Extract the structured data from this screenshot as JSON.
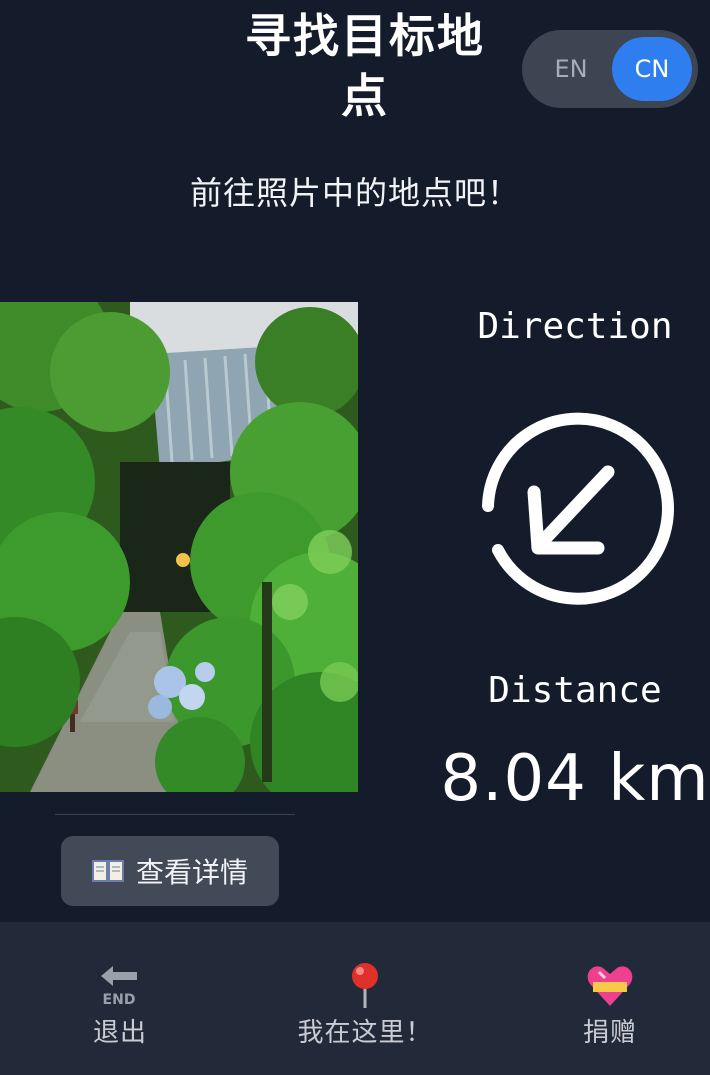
{
  "header": {
    "title": "寻找目标地点",
    "language": {
      "en": "EN",
      "cn": "CN",
      "active": "CN"
    }
  },
  "subtitle": "前往照片中的地点吧！",
  "main": {
    "photo_icon": "photo-of-temple-garden",
    "details_button": {
      "icon": "book-icon",
      "label": "查看详情"
    },
    "direction_label": "Direction",
    "direction_icon": "arrow-down-left-icon",
    "distance_label": "Distance",
    "distance_value": "8.04 km"
  },
  "bottom_nav": [
    {
      "label": "退出",
      "icon": "end-arrow-icon",
      "icon_text": "END"
    },
    {
      "label": "我在这里！",
      "icon": "red-pin-icon"
    },
    {
      "label": "捐赠",
      "icon": "heart-icon"
    }
  ],
  "colors": {
    "background": "#141c2b",
    "bottom_bar": "#222938",
    "accent": "#2f7ef0",
    "button": "#424957"
  }
}
